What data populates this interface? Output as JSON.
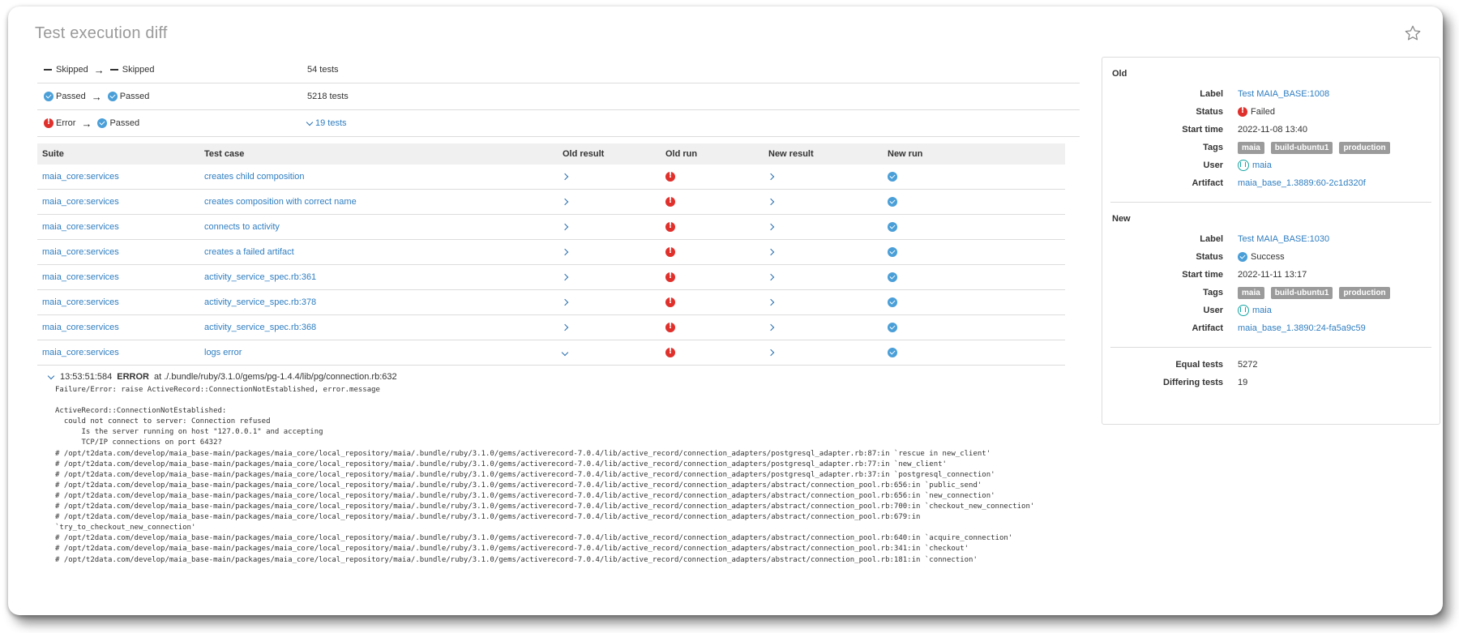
{
  "title": "Test execution diff",
  "summary": [
    {
      "from_status": "Skipped",
      "from_icon": "dash-icon",
      "to_status": "Skipped",
      "to_icon": "dash-icon",
      "count": "54 tests",
      "expandable": false
    },
    {
      "from_status": "Passed",
      "from_icon": "passed-icon",
      "to_status": "Passed",
      "to_icon": "passed-icon",
      "count": "5218 tests",
      "expandable": false
    },
    {
      "from_status": "Error",
      "from_icon": "error-icon",
      "to_status": "Passed",
      "to_icon": "passed-icon",
      "count": "19 tests",
      "expandable": true
    }
  ],
  "table": {
    "headers": [
      "Suite",
      "Test case",
      "Old result",
      "Old run",
      "New result",
      "New run"
    ],
    "rows": [
      {
        "suite": "maia_core:services",
        "case": "creates child composition"
      },
      {
        "suite": "maia_core:services",
        "case": "creates composition with correct name"
      },
      {
        "suite": "maia_core:services",
        "case": "connects to activity"
      },
      {
        "suite": "maia_core:services",
        "case": "creates a failed artifact"
      },
      {
        "suite": "maia_core:services",
        "case": "activity_service_spec.rb:361"
      },
      {
        "suite": "maia_core:services",
        "case": "activity_service_spec.rb:378"
      },
      {
        "suite": "maia_core:services",
        "case": "activity_service_spec.rb:368"
      },
      {
        "suite": "maia_core:services",
        "case": "logs error"
      }
    ]
  },
  "log": {
    "time": "13:53:51:584",
    "level": "ERROR",
    "location": "at ./.bundle/ruby/3.1.0/gems/pg-1.4.4/lib/pg/connection.rb:632",
    "body": "Failure/Error: raise ActiveRecord::ConnectionNotEstablished, error.message\n\nActiveRecord::ConnectionNotEstablished:\n  could not connect to server: Connection refused\n      Is the server running on host \"127.0.0.1\" and accepting\n      TCP/IP connections on port 6432?\n# /opt/t2data.com/develop/maia_base-main/packages/maia_core/local_repository/maia/.bundle/ruby/3.1.0/gems/activerecord-7.0.4/lib/active_record/connection_adapters/postgresql_adapter.rb:87:in `rescue in new_client'\n# /opt/t2data.com/develop/maia_base-main/packages/maia_core/local_repository/maia/.bundle/ruby/3.1.0/gems/activerecord-7.0.4/lib/active_record/connection_adapters/postgresql_adapter.rb:77:in `new_client'\n# /opt/t2data.com/develop/maia_base-main/packages/maia_core/local_repository/maia/.bundle/ruby/3.1.0/gems/activerecord-7.0.4/lib/active_record/connection_adapters/postgresql_adapter.rb:37:in `postgresql_connection'\n# /opt/t2data.com/develop/maia_base-main/packages/maia_core/local_repository/maia/.bundle/ruby/3.1.0/gems/activerecord-7.0.4/lib/active_record/connection_adapters/abstract/connection_pool.rb:656:in `public_send'\n# /opt/t2data.com/develop/maia_base-main/packages/maia_core/local_repository/maia/.bundle/ruby/3.1.0/gems/activerecord-7.0.4/lib/active_record/connection_adapters/abstract/connection_pool.rb:656:in `new_connection'\n# /opt/t2data.com/develop/maia_base-main/packages/maia_core/local_repository/maia/.bundle/ruby/3.1.0/gems/activerecord-7.0.4/lib/active_record/connection_adapters/abstract/connection_pool.rb:700:in `checkout_new_connection'\n# /opt/t2data.com/develop/maia_base-main/packages/maia_core/local_repository/maia/.bundle/ruby/3.1.0/gems/activerecord-7.0.4/lib/active_record/connection_adapters/abstract/connection_pool.rb:679:in\n`try_to_checkout_new_connection'\n# /opt/t2data.com/develop/maia_base-main/packages/maia_core/local_repository/maia/.bundle/ruby/3.1.0/gems/activerecord-7.0.4/lib/active_record/connection_adapters/abstract/connection_pool.rb:640:in `acquire_connection'\n# /opt/t2data.com/develop/maia_base-main/packages/maia_core/local_repository/maia/.bundle/ruby/3.1.0/gems/activerecord-7.0.4/lib/active_record/connection_adapters/abstract/connection_pool.rb:341:in `checkout'\n# /opt/t2data.com/develop/maia_base-main/packages/maia_core/local_repository/maia/.bundle/ruby/3.1.0/gems/activerecord-7.0.4/lib/active_record/connection_adapters/abstract/connection_pool.rb:181:in `connection'"
  },
  "panel": {
    "old": {
      "heading": "Old",
      "labels": {
        "label": "Label",
        "status": "Status",
        "start": "Start time",
        "tags": "Tags",
        "user": "User",
        "artifact": "Artifact"
      },
      "label_value": "Test MAIA_BASE:1008",
      "status_value": "Failed",
      "status_icon": "error-icon",
      "start_value": "2022-11-08 13:40",
      "tags": [
        "maia",
        "build-ubuntu1",
        "production"
      ],
      "user": "maia",
      "artifact": "maia_base_1.3889:60-2c1d320f"
    },
    "new": {
      "heading": "New",
      "labels": {
        "label": "Label",
        "status": "Status",
        "start": "Start time",
        "tags": "Tags",
        "user": "User",
        "artifact": "Artifact"
      },
      "label_value": "Test MAIA_BASE:1030",
      "status_value": "Success",
      "status_icon": "passed-icon",
      "start_value": "2022-11-11 13:17",
      "tags": [
        "maia",
        "build-ubuntu1",
        "production"
      ],
      "user": "maia",
      "artifact": "maia_base_1.3890:24-fa5a9c59"
    },
    "stats": [
      {
        "label": "Equal tests",
        "value": "5272"
      },
      {
        "label": "Differing tests",
        "value": "19"
      }
    ]
  }
}
